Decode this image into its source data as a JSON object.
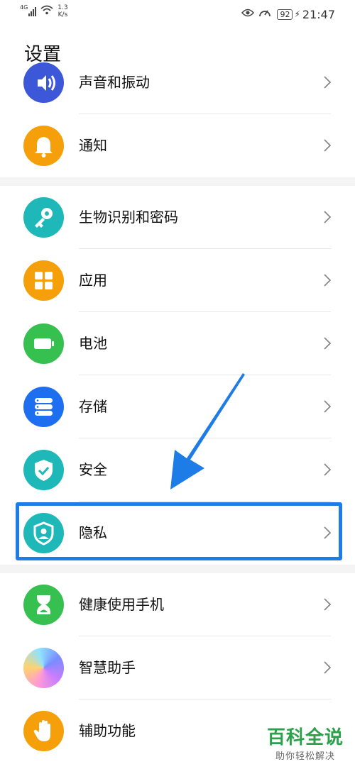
{
  "status_bar": {
    "network_type": "4G",
    "net_speed_value": "1.3",
    "net_speed_unit": "K/s",
    "battery": "92",
    "time": "21:47"
  },
  "header": {
    "title": "设置"
  },
  "items": [
    {
      "label": "声音和振动",
      "icon": "speaker-icon",
      "color": "#3d57d9"
    },
    {
      "label": "通知",
      "icon": "bell-icon",
      "color": "#f5a00a"
    },
    {
      "label": "生物识别和密码",
      "icon": "key-icon",
      "color": "#1fb8b8"
    },
    {
      "label": "应用",
      "icon": "apps-grid-icon",
      "color": "#f5a00a"
    },
    {
      "label": "电池",
      "icon": "battery-icon",
      "color": "#35c04f"
    },
    {
      "label": "存储",
      "icon": "storage-icon",
      "color": "#1e6ff0"
    },
    {
      "label": "安全",
      "icon": "shield-check-icon",
      "color": "#1fb8b8"
    },
    {
      "label": "隐私",
      "icon": "privacy-shield-icon",
      "color": "#1fb8b8"
    },
    {
      "label": "健康使用手机",
      "icon": "hourglass-icon",
      "color": "#35c04f"
    },
    {
      "label": "智慧助手",
      "icon": "assistant-orb-icon",
      "color": "#c77dff"
    },
    {
      "label": "辅助功能",
      "icon": "hand-icon",
      "color": "#f5a00a"
    }
  ],
  "highlight_color": "#1e7ce6",
  "watermark": {
    "title": "百科全说",
    "subtitle": "助你轻松解决"
  }
}
